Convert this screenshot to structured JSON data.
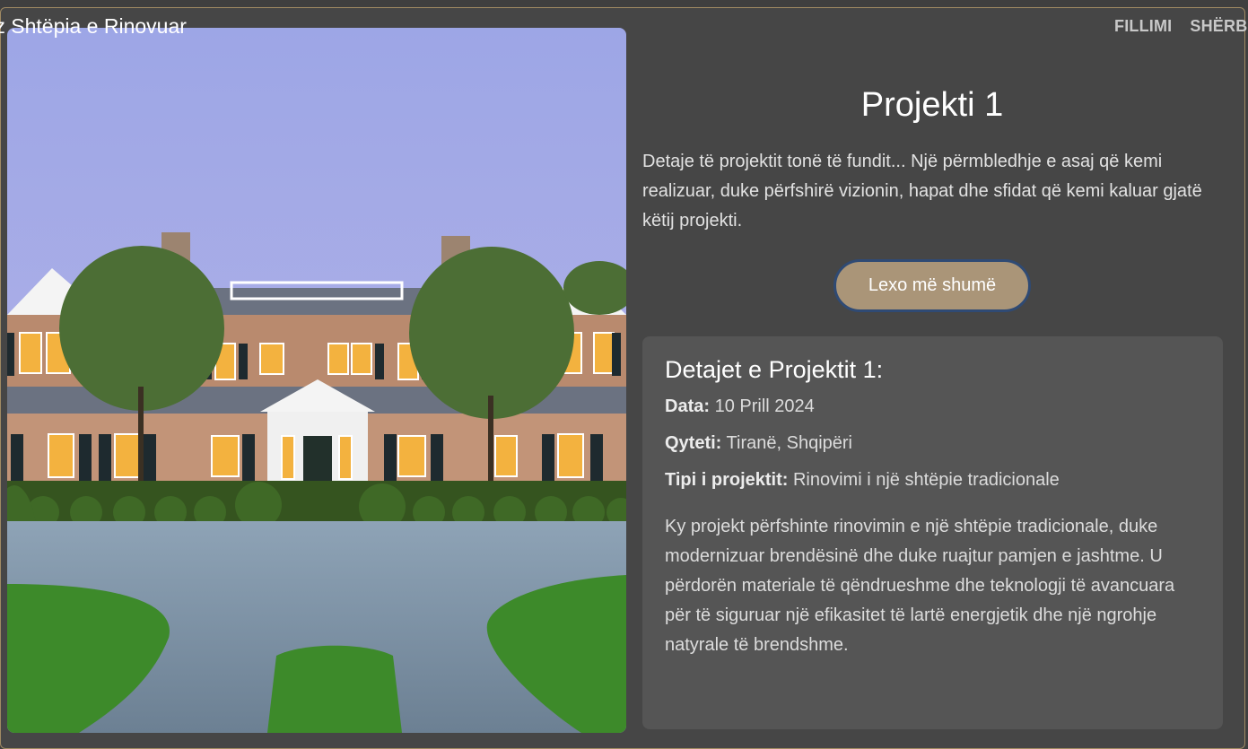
{
  "header": {
    "site_title": "tz Shtëpia e Rinovuar",
    "nav": [
      "FILLIMI",
      "SHËRB"
    ]
  },
  "project": {
    "title": "Projekti 1",
    "description": "Detaje të projektit tonë të fundit... Një përmbledhje e asaj që kemi realizuar, duke përfshirë vizionin, hapat dhe sfidat që kemi kaluar gjatë këtij projekti.",
    "read_more_label": "Lexo më shumë"
  },
  "details": {
    "heading": "Detajet e Projektit 1:",
    "date_label": "Data:",
    "date_value": "10 Prill 2024",
    "city_label": "Qyteti:",
    "city_value": "Tiranë, Shqipëri",
    "type_label": "Tipi i projektit:",
    "type_value": "Rinovimi i një shtëpie tradicionale",
    "text": "Ky projekt përfshinte rinovimin e një shtëpie tradicionale, duke modernizuar brendësinë dhe duke ruajtur pamjen e jashtme. U përdorën materiale të qëndrueshme dhe teknologji të avancuara për të siguruar një efikasitet të lartë energjetik dhe një ngrohje natyrale të brendshme."
  },
  "colors": {
    "background": "#464646",
    "panel": "#555555",
    "button": "#aa9578",
    "button_border": "#2f4a74",
    "frame_border": "#a08a63"
  }
}
